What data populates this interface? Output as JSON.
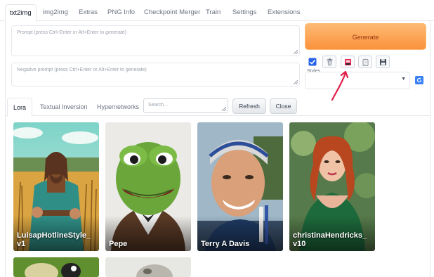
{
  "top_tabs": [
    "txt2img",
    "img2img",
    "Extras",
    "PNG Info",
    "Checkpoint Merger",
    "Train",
    "Settings",
    "Extensions"
  ],
  "active_top_tab": "txt2img",
  "prompt": {
    "placeholder": "Prompt (press Ctrl+Enter or Alt+Enter to generate)",
    "value": ""
  },
  "negative_prompt": {
    "placeholder": "Negative prompt (press Ctrl+Enter or Alt+Enter to generate)",
    "value": ""
  },
  "generate_label": "Generate",
  "tool_buttons": [
    {
      "icon": "checkbox-icon"
    },
    {
      "icon": "trash-icon"
    },
    {
      "icon": "extra-networks-icon"
    },
    {
      "icon": "clipboard-icon"
    },
    {
      "icon": "save-icon"
    }
  ],
  "styles": {
    "label": "Styles",
    "value": ""
  },
  "extra_tabs": [
    "Lora",
    "Textual Inversion",
    "Hypernetworks"
  ],
  "active_extra_tab": "Lora",
  "search": {
    "placeholder": "Search..."
  },
  "refresh_label": "Refresh",
  "close_label": "Close",
  "cards": [
    {
      "label": "LuisapHotlineStyle_ v1"
    },
    {
      "label": "Pepe"
    },
    {
      "label": "Terry A Davis"
    },
    {
      "label": "christinaHendricks_ v10"
    }
  ],
  "colors": {
    "generate_bg": "#fb923c",
    "accent_blue": "#3b82f6",
    "annotation_red": "#e11d48"
  }
}
